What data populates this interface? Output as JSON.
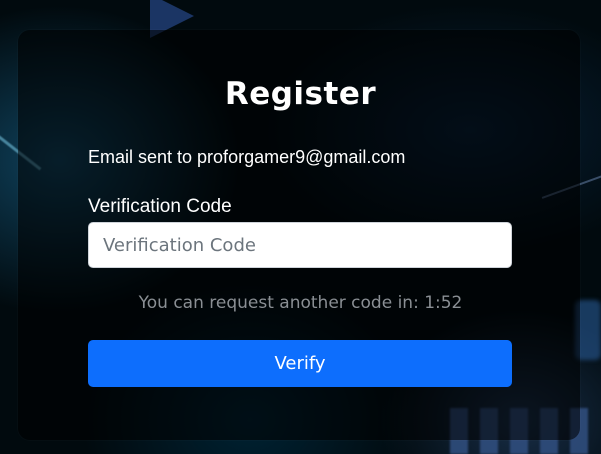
{
  "form": {
    "title": "Register",
    "email_sent_text": "Email sent to proforgamer9@gmail.com",
    "code_label": "Verification Code",
    "code_input": {
      "value": "",
      "placeholder": "Verification Code"
    },
    "resend_countdown_text": "You can request another code in: 1:52",
    "verify_button_label": "Verify"
  },
  "colors": {
    "primary_button": "#0d6efd",
    "card_overlay": "rgba(0,0,0,0.55)",
    "muted_text": "#8a8f94"
  }
}
